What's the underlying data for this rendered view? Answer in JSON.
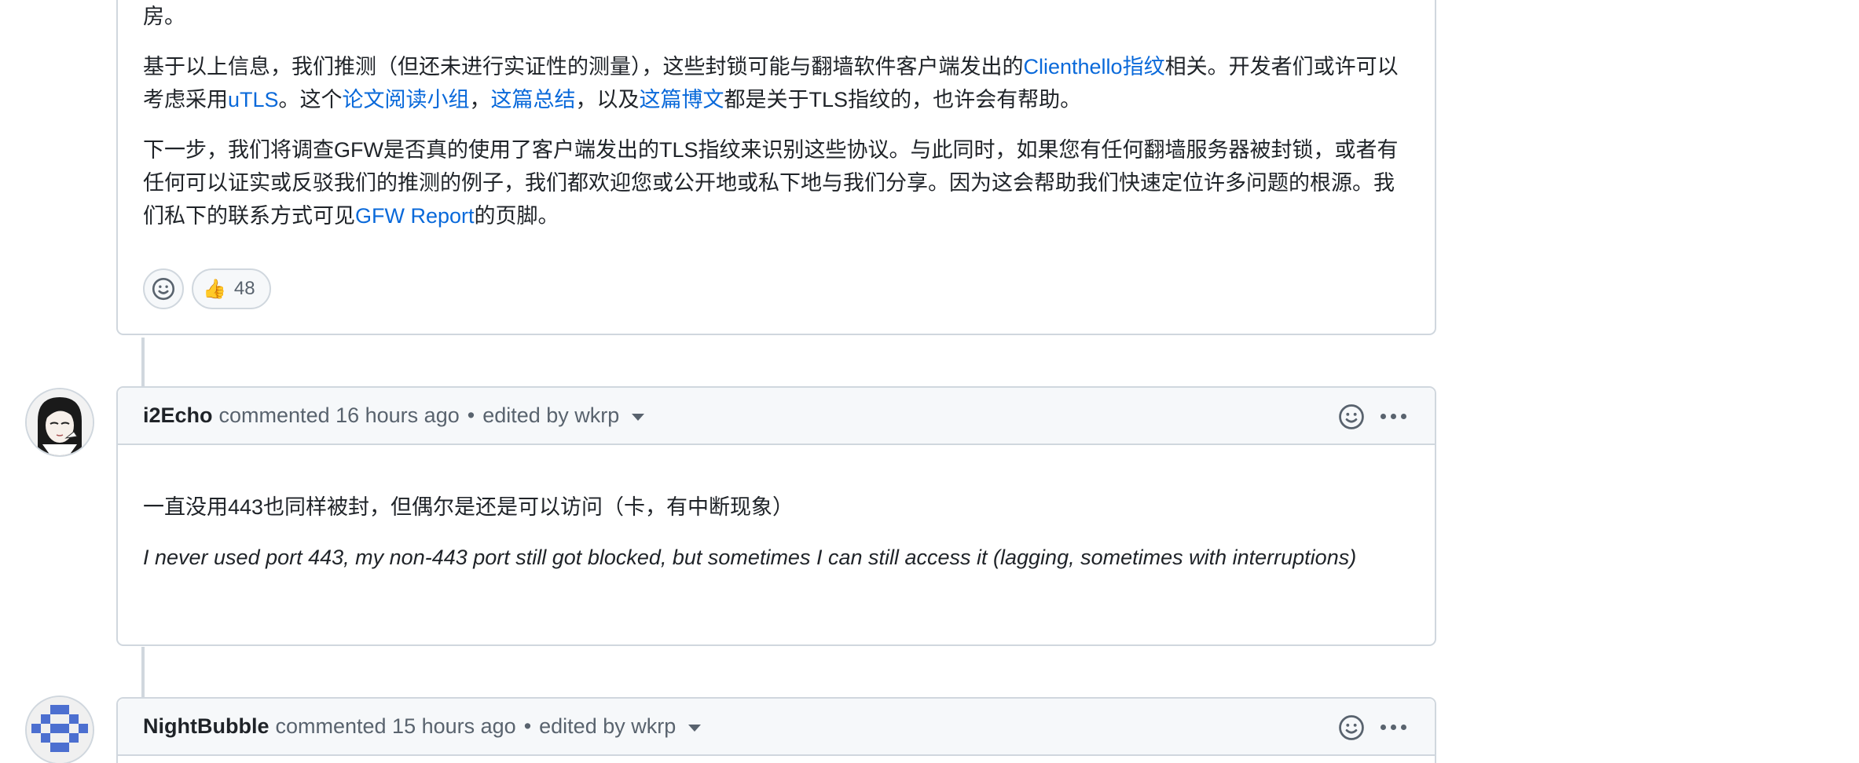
{
  "comment1": {
    "partial_top": "房。",
    "para1": [
      {
        "t": "基于以上信息，我们推测（但还未进行实证性的测量），这些封锁可能与翻墙软件客户端发出的"
      },
      {
        "t": "Clienthello指纹",
        "link": true
      },
      {
        "t": "相关。开发者们或许可以考虑采用"
      },
      {
        "t": "uTLS",
        "link": true
      },
      {
        "t": "。这个"
      },
      {
        "t": "论文阅读小组",
        "link": true
      },
      {
        "t": "，"
      },
      {
        "t": "这篇总结",
        "link": true
      },
      {
        "t": "，以及"
      },
      {
        "t": "这篇博文",
        "link": true
      },
      {
        "t": "都是关于TLS指纹的，也许会有帮助。"
      }
    ],
    "para2_text": "下一步，我们将调查GFW是否真的使用了客户端发出的TLS指纹来识别这些协议。与此同时，如果您有任何翻墙服务器被封锁，或者有任何可以证实或反驳我们的推测的例子，我们都欢迎您或公开地或私下地与我们分享。因为这会帮助我们快速定位许多问题的根源。我们私下的联系方式可见",
    "para2_link": "GFW Report",
    "para2_end": "的页脚。",
    "reaction_emoji": "👍",
    "reaction_count": "48"
  },
  "comment2": {
    "author": "i2Echo",
    "meta": "commented 16 hours ago",
    "edited": "edited by wkrp",
    "body_zh": "一直没用443也同样被封，但偶尔是还是可以访问（卡，有中断现象）",
    "body_en": "I never used port 443, my non-443 port still got blocked, but sometimes I can still access it (lagging, sometimes with interruptions)"
  },
  "comment3": {
    "author": "NightBubble",
    "meta": "commented 15 hours ago",
    "edited": "edited by wkrp"
  },
  "separator": "•",
  "colors": {
    "link": "#0969da",
    "border": "#d0d7de",
    "header_bg": "#f6f8fa",
    "muted": "#59636e",
    "identicon": "#4c6fd0"
  }
}
